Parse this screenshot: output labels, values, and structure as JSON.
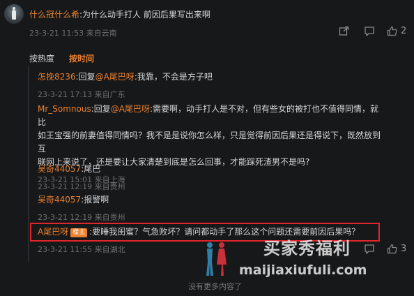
{
  "main_comment": {
    "username": "什么冠什么希",
    "text": ":为什么动手打人 前因后果写出来啊",
    "meta": "23-3-21 11:53 来自云南",
    "like_count": "2",
    "icons": [
      "share-icon",
      "comment-icon",
      "like-icon"
    ]
  },
  "sort": {
    "hot_label": "按热度",
    "time_label": "按时间",
    "active": "time"
  },
  "replies": [
    {
      "name": "怎挽8236",
      "prefix": ":回复",
      "at": "@A尾巴呀",
      "text": ":我靠，不会是方子吧",
      "meta": "23-3-21 17:13 来自广东"
    },
    {
      "name": "Mr_Somnous",
      "prefix": ":回复",
      "at": "@A尾巴呀",
      "line1": ":需要啊，动手打人是不对，但有些女的被打也不值得同情，就比",
      "line2": "如王宝强的前妻值得同情吗？我不是是说你怎么样，只是觉得前因后果还是得说下，既然放到互",
      "line3": "联网上来说了，还是要让大家清楚到底是怎么回事，才能踩死渣男不是吗?",
      "meta": "23-3-21 15:01 来自上海"
    },
    {
      "name": "吴奇44057",
      "text": ":尾巴",
      "meta": "23-3-21 12:19 来自贵州"
    },
    {
      "name": "吴奇44057",
      "text": ":报警啊",
      "meta": "23-3-21 12:19 来自贵州"
    },
    {
      "name": "A尾巴呀",
      "badge": "楼主",
      "text": ":要睡我闺蜜？气急败坏？请问都动手了那么这个问题还需要前因后果吗？",
      "meta": "23-3-21 11:55 来自湖北"
    }
  ],
  "reply_like_count": "3",
  "watermark": {
    "line1": "买家秀福利",
    "line2": "maijiaxiufuli.com"
  },
  "footer": "没有更多内容了",
  "colors": {
    "accent": "#e9802e",
    "highlight_box": "#e0262b",
    "background": "#17181a"
  }
}
